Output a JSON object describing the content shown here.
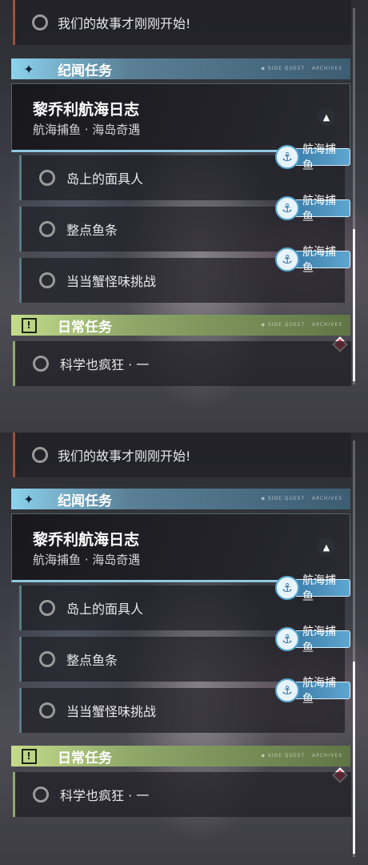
{
  "panels": [
    {
      "top_task": "我们的故事才刚刚开始!",
      "story_header": "纪闻任务",
      "header_deco": "◆ SIDE QUEST · ARCHIVES",
      "chapter_title": "黎乔利航海日志",
      "chapter_subtitle": "航海捕鱼 · 海岛奇遇",
      "tasks": [
        {
          "label": "岛上的面具人",
          "tag": "航海捕鱼"
        },
        {
          "label": "整点鱼条",
          "tag": "航海捕鱼"
        },
        {
          "label": "当当蟹怪味挑战",
          "tag": "航海捕鱼"
        }
      ],
      "daily_header": "日常任务",
      "daily_task": "科学也疯狂 · 一"
    },
    {
      "top_task": "我们的故事才刚刚开始!",
      "story_header": "纪闻任务",
      "header_deco": "◆ SIDE QUEST · ARCHIVES",
      "chapter_title": "黎乔利航海日志",
      "chapter_subtitle": "航海捕鱼 · 海岛奇遇",
      "tasks": [
        {
          "label": "岛上的面具人",
          "tag": "航海捕鱼"
        },
        {
          "label": "整点鱼条",
          "tag": "航海捕鱼"
        },
        {
          "label": "当当蟹怪味挑战",
          "tag": "航海捕鱼"
        }
      ],
      "daily_header": "日常任务",
      "daily_task": "科学也疯狂 · 一"
    }
  ],
  "icons": {
    "story": "sparkle-icon",
    "daily": "exclamation-icon",
    "tag": "anchor-icon",
    "expand": "chevron-up-icon",
    "status": "circle-icon"
  },
  "colors": {
    "story_accent": "#8cd2ee",
    "daily_accent": "#c4dc8a",
    "tag_blue": "#3c7eab",
    "alert_red": "#e04050"
  }
}
